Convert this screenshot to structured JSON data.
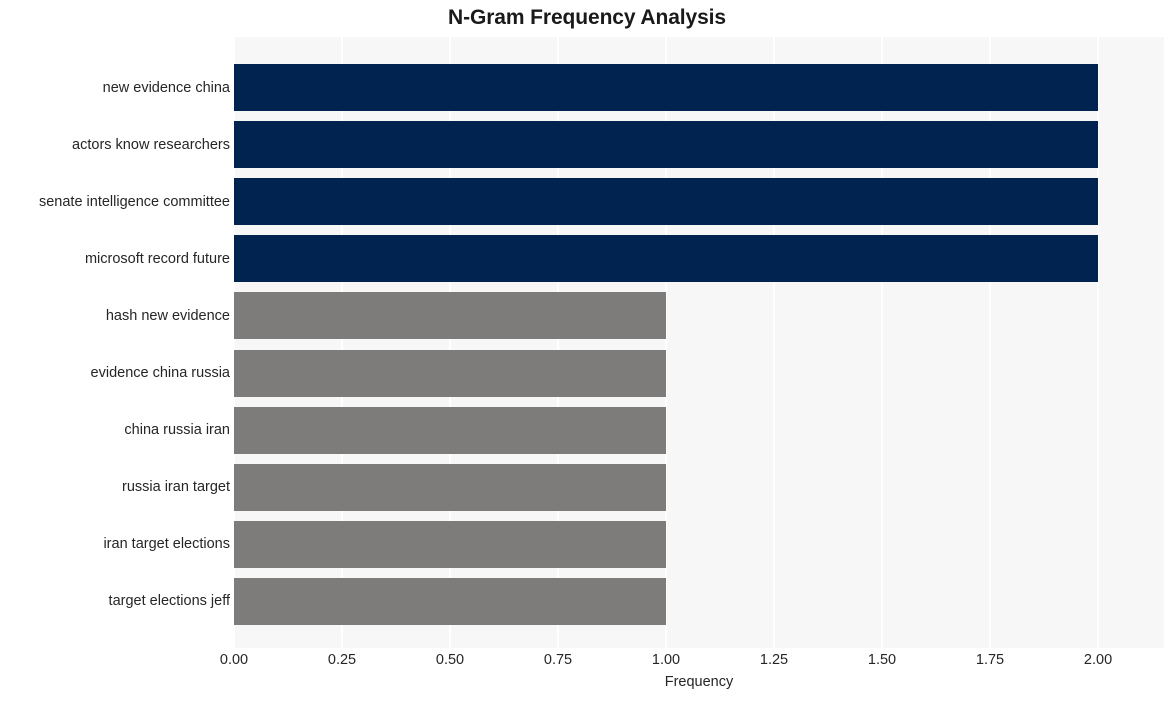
{
  "chart_data": {
    "type": "bar",
    "orientation": "horizontal",
    "title": "N-Gram Frequency Analysis",
    "xlabel": "Frequency",
    "ylabel": "",
    "categories": [
      "new evidence china",
      "actors know researchers",
      "senate intelligence committee",
      "microsoft record future",
      "hash new evidence",
      "evidence china russia",
      "china russia iran",
      "russia iran target",
      "iran target elections",
      "target elections jeff"
    ],
    "values": [
      2,
      2,
      2,
      2,
      1,
      1,
      1,
      1,
      1,
      1
    ],
    "bar_colors": [
      "#002350",
      "#002350",
      "#002350",
      "#002350",
      "#7d7c7a",
      "#7d7c7a",
      "#7d7c7a",
      "#7d7c7a",
      "#7d7c7a",
      "#7d7c7a"
    ],
    "xlim": [
      0,
      2.1527
    ],
    "xticks": [
      0,
      0.25,
      0.5,
      0.75,
      1,
      1.25,
      1.5,
      1.75,
      2
    ],
    "xtick_labels": [
      "0.00",
      "0.25",
      "0.50",
      "0.75",
      "1.00",
      "1.25",
      "1.50",
      "1.75",
      "2.00"
    ],
    "grid": true,
    "grid_axis": "x",
    "legend": null,
    "plot_background": "#f7f7f7",
    "figure_background": "#ffffff",
    "gridline_color": "#ffffff"
  }
}
